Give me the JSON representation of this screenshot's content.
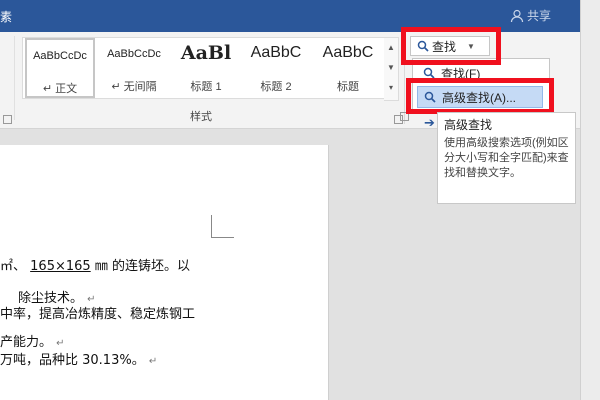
{
  "title_fragment": "素",
  "share": {
    "label": "共享"
  },
  "ribbon": {
    "styles": [
      {
        "preview": "AaBbCcDc",
        "label": "↵ 正文",
        "selected": true
      },
      {
        "preview": "AaBbCcDc",
        "label": "↵ 无间隔",
        "selected": false
      },
      {
        "preview": "AaBl",
        "label": "标题 1",
        "selected": false
      },
      {
        "preview": "AaBbC",
        "label": "标题 2",
        "selected": false
      },
      {
        "preview": "AaBbC",
        "label": "标题",
        "selected": false
      }
    ],
    "group_label": "样式"
  },
  "find": {
    "button_label": "查找",
    "menu_items": [
      {
        "label": "查找(F)"
      },
      {
        "label": "高级查找(A)..."
      }
    ]
  },
  "tooltip": {
    "title": "高级查找",
    "body": "使用高级搜索选项(例如区分大小写和全字匹配)来查找和替换文字。"
  },
  "document": {
    "line1_a": "㎡、",
    "line1_b": "165×165",
    "line1_c": " ㎜",
    "line1_d": "的连铸坯。以",
    "line2": "除尘技术。",
    "line3": "中率，提高冶炼精度、稳定炼钢工",
    "line4": "产能力。",
    "line5": "万吨，品种比 30.13%。",
    "return_mark": "↵"
  },
  "colors": {
    "title_bar": "#2b579a",
    "highlight": "#f0101e",
    "hover": "#c5daf5"
  }
}
